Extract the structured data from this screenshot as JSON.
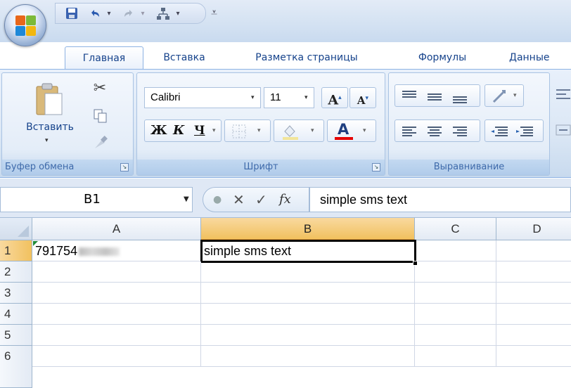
{
  "quick_access": {
    "save_icon": "save-icon",
    "undo_icon": "undo-icon",
    "redo_icon": "redo-icon",
    "custom_icon": "org-chart-icon",
    "customize_icon": "customize-qat-icon"
  },
  "tabs": [
    {
      "label": "Главная",
      "active": true
    },
    {
      "label": "Вставка"
    },
    {
      "label": "Разметка страницы"
    },
    {
      "label": "Формулы"
    },
    {
      "label": "Данные"
    }
  ],
  "clipboard": {
    "paste_label": "Вставить",
    "group_label": "Буфер обмена"
  },
  "font": {
    "name": "Calibri",
    "size": "11",
    "bold": "Ж",
    "italic": "К",
    "underline": "Ч",
    "grow": "A",
    "shrink": "A",
    "font_color_label": "A",
    "font_color": "#e60000",
    "group_label": "Шрифт"
  },
  "alignment": {
    "group_label": "Выравнивание"
  },
  "formula_bar": {
    "name_box": "B1",
    "cancel": "✕",
    "enter": "✓",
    "fx": "fx",
    "value": "simple sms text"
  },
  "sheet": {
    "columns": [
      "A",
      "B",
      "C",
      "D"
    ],
    "selected_column": "B",
    "rows": [
      "1",
      "2",
      "3",
      "4",
      "5",
      "6"
    ],
    "selected_row": "1",
    "active_cell": "B1",
    "cells": {
      "A1": "791754",
      "B1": "simple sms text"
    }
  }
}
